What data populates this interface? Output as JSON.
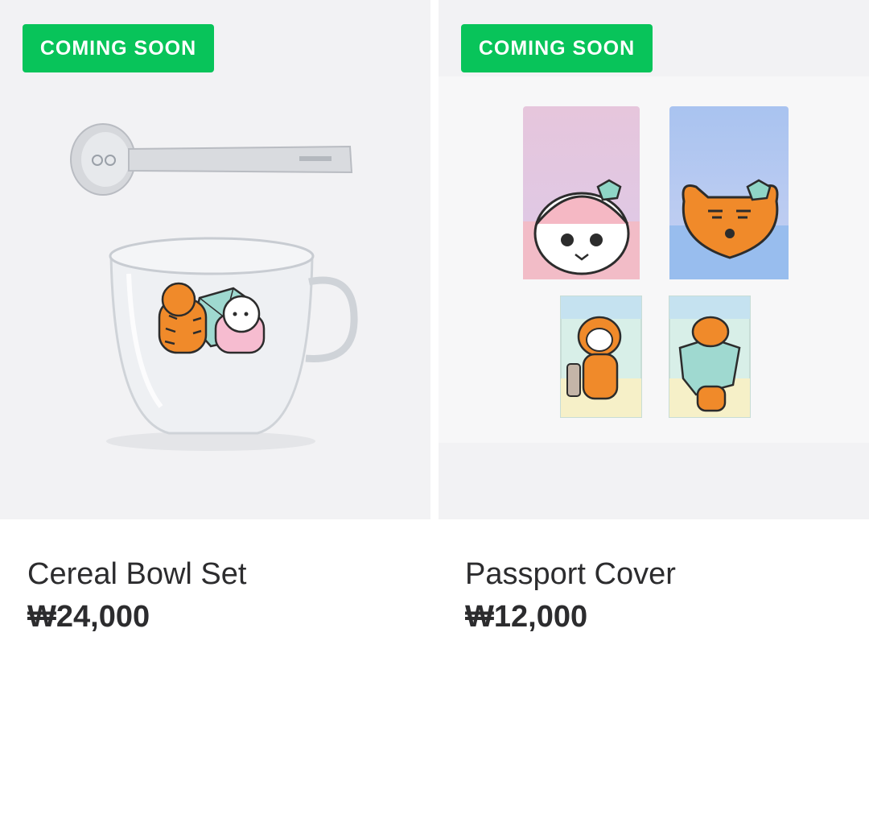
{
  "products": [
    {
      "badge": "COMING SOON",
      "name": "Cereal Bowl Set",
      "price": "₩24,000",
      "image_icon": "cereal-bowl-set-image"
    },
    {
      "badge": "COMING SOON",
      "name": "Passport Cover",
      "price": "₩12,000",
      "image_icon": "passport-cover-image"
    }
  ],
  "colors": {
    "badge_bg": "#08c45a",
    "tile_bg": "#f2f2f4",
    "text": "#2c2c2e"
  }
}
